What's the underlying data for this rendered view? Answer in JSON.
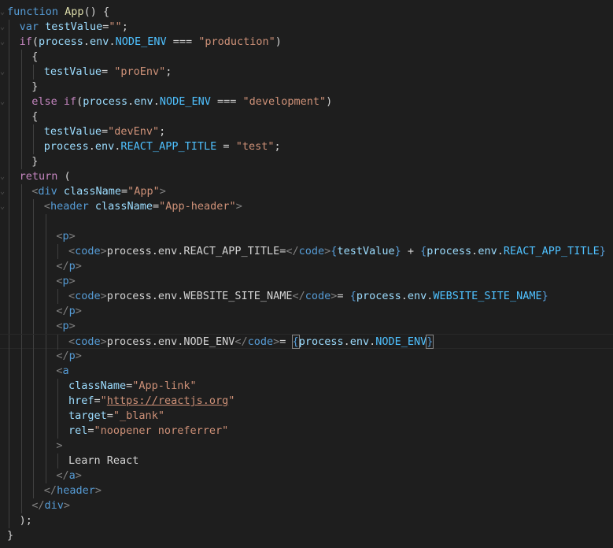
{
  "colors": {
    "background": "#1e1e1e",
    "keyword": "#569cd6",
    "control": "#c586c0",
    "function": "#dcdcaa",
    "variable": "#9cdcfe",
    "constant": "#4fc1ff",
    "string": "#ce9178",
    "tag": "#569cd6",
    "tag_bracket": "#808080",
    "text": "#d4d4d4"
  },
  "editor": {
    "lines": [
      {
        "indent": 0,
        "tokens": [
          [
            "function",
            "k"
          ],
          [
            " ",
            "t"
          ],
          [
            "App",
            "f"
          ],
          [
            "() {",
            "t"
          ]
        ]
      },
      {
        "indent": 1,
        "tokens": [
          [
            "var",
            "k"
          ],
          [
            " ",
            "t"
          ],
          [
            "testValue",
            "v"
          ],
          [
            "=",
            "t"
          ],
          [
            "\"\"",
            "s"
          ],
          [
            ";",
            "t"
          ]
        ]
      },
      {
        "indent": 1,
        "tokens": [
          [
            "if",
            "c"
          ],
          [
            "(",
            "t"
          ],
          [
            "process",
            "v"
          ],
          [
            ".",
            "t"
          ],
          [
            "env",
            "v"
          ],
          [
            ".",
            "t"
          ],
          [
            "NODE_ENV",
            "n"
          ],
          [
            " === ",
            "t"
          ],
          [
            "\"production\"",
            "s"
          ],
          [
            ")",
            "t"
          ]
        ]
      },
      {
        "indent": 2,
        "tokens": [
          [
            "{",
            "t"
          ]
        ]
      },
      {
        "indent": 3,
        "tokens": [
          [
            "testValue",
            "v"
          ],
          [
            "= ",
            "t"
          ],
          [
            "\"proEnv\"",
            "s"
          ],
          [
            ";",
            "t"
          ]
        ]
      },
      {
        "indent": 2,
        "tokens": [
          [
            "}",
            "t"
          ]
        ]
      },
      {
        "indent": 2,
        "tokens": [
          [
            "else",
            "c"
          ],
          [
            " ",
            "t"
          ],
          [
            "if",
            "c"
          ],
          [
            "(",
            "t"
          ],
          [
            "process",
            "v"
          ],
          [
            ".",
            "t"
          ],
          [
            "env",
            "v"
          ],
          [
            ".",
            "t"
          ],
          [
            "NODE_ENV",
            "n"
          ],
          [
            " === ",
            "t"
          ],
          [
            "\"development\"",
            "s"
          ],
          [
            ")",
            "t"
          ]
        ]
      },
      {
        "indent": 2,
        "tokens": [
          [
            "{",
            "t"
          ]
        ]
      },
      {
        "indent": 3,
        "tokens": [
          [
            "testValue",
            "v"
          ],
          [
            "=",
            "t"
          ],
          [
            "\"devEnv\"",
            "s"
          ],
          [
            ";",
            "t"
          ]
        ]
      },
      {
        "indent": 3,
        "tokens": [
          [
            "process",
            "v"
          ],
          [
            ".",
            "t"
          ],
          [
            "env",
            "v"
          ],
          [
            ".",
            "t"
          ],
          [
            "REACT_APP_TITLE",
            "n"
          ],
          [
            " = ",
            "t"
          ],
          [
            "\"test\"",
            "s"
          ],
          [
            ";",
            "t"
          ]
        ]
      },
      {
        "indent": 2,
        "tokens": [
          [
            "}",
            "t"
          ]
        ]
      },
      {
        "indent": 1,
        "tokens": [
          [
            "return",
            "c"
          ],
          [
            " (",
            "t"
          ]
        ]
      },
      {
        "indent": 2,
        "tokens": [
          [
            "<",
            "b"
          ],
          [
            "div",
            "g"
          ],
          [
            " ",
            "t"
          ],
          [
            "className",
            "v"
          ],
          [
            "=",
            "t"
          ],
          [
            "\"App\"",
            "s"
          ],
          [
            ">",
            "b"
          ]
        ]
      },
      {
        "indent": 3,
        "tokens": [
          [
            "<",
            "b"
          ],
          [
            "header",
            "g"
          ],
          [
            " ",
            "t"
          ],
          [
            "className",
            "v"
          ],
          [
            "=",
            "t"
          ],
          [
            "\"App-header\"",
            "s"
          ],
          [
            ">",
            "b"
          ]
        ]
      },
      {
        "indent": 4,
        "tokens": []
      },
      {
        "indent": 4,
        "tokens": [
          [
            "<",
            "b"
          ],
          [
            "p",
            "g"
          ],
          [
            ">",
            "b"
          ]
        ]
      },
      {
        "indent": 5,
        "tokens": [
          [
            "<",
            "b"
          ],
          [
            "code",
            "g"
          ],
          [
            ">",
            "b"
          ],
          [
            "process.env.REACT_APP_TITLE=",
            "t"
          ],
          [
            "</",
            "b"
          ],
          [
            "code",
            "g"
          ],
          [
            ">",
            "b"
          ],
          [
            "{",
            "k"
          ],
          [
            "testValue",
            "v"
          ],
          [
            "}",
            "k"
          ],
          [
            " + ",
            "t"
          ],
          [
            "{",
            "k"
          ],
          [
            "process",
            "v"
          ],
          [
            ".",
            "t"
          ],
          [
            "env",
            "v"
          ],
          [
            ".",
            "t"
          ],
          [
            "REACT_APP_TITLE",
            "n"
          ],
          [
            "}",
            "k"
          ]
        ]
      },
      {
        "indent": 4,
        "tokens": [
          [
            "</",
            "b"
          ],
          [
            "p",
            "g"
          ],
          [
            ">",
            "b"
          ]
        ]
      },
      {
        "indent": 4,
        "tokens": [
          [
            "<",
            "b"
          ],
          [
            "p",
            "g"
          ],
          [
            ">",
            "b"
          ]
        ]
      },
      {
        "indent": 5,
        "tokens": [
          [
            "<",
            "b"
          ],
          [
            "code",
            "g"
          ],
          [
            ">",
            "b"
          ],
          [
            "process.env.WEBSITE_SITE_NAME",
            "t"
          ],
          [
            "</",
            "b"
          ],
          [
            "code",
            "g"
          ],
          [
            ">",
            "b"
          ],
          [
            "= ",
            "t"
          ],
          [
            "{",
            "k"
          ],
          [
            "process",
            "v"
          ],
          [
            ".",
            "t"
          ],
          [
            "env",
            "v"
          ],
          [
            ".",
            "t"
          ],
          [
            "WEBSITE_SITE_NAME",
            "n"
          ],
          [
            "}",
            "k"
          ]
        ]
      },
      {
        "indent": 4,
        "tokens": [
          [
            "</",
            "b"
          ],
          [
            "p",
            "g"
          ],
          [
            ">",
            "b"
          ]
        ]
      },
      {
        "indent": 4,
        "tokens": [
          [
            "<",
            "b"
          ],
          [
            "p",
            "g"
          ],
          [
            ">",
            "b"
          ]
        ]
      },
      {
        "indent": 5,
        "tokens": [
          [
            "<",
            "b"
          ],
          [
            "code",
            "g"
          ],
          [
            ">",
            "b"
          ],
          [
            "process.env.NODE_ENV",
            "t"
          ],
          [
            "</",
            "b"
          ],
          [
            "code",
            "g"
          ],
          [
            ">",
            "b"
          ],
          [
            "= ",
            "t"
          ],
          [
            "{",
            "kb"
          ],
          [
            "process",
            "v"
          ],
          [
            ".",
            "t"
          ],
          [
            "env",
            "v"
          ],
          [
            ".",
            "t"
          ],
          [
            "NODE_ENV",
            "n"
          ],
          [
            "}",
            "kb"
          ]
        ]
      },
      {
        "indent": 4,
        "tokens": [
          [
            "</",
            "b"
          ],
          [
            "p",
            "g"
          ],
          [
            ">",
            "b"
          ]
        ]
      },
      {
        "indent": 4,
        "tokens": [
          [
            "<",
            "b"
          ],
          [
            "a",
            "g"
          ]
        ]
      },
      {
        "indent": 5,
        "tokens": [
          [
            "className",
            "v"
          ],
          [
            "=",
            "t"
          ],
          [
            "\"App-link\"",
            "s"
          ]
        ]
      },
      {
        "indent": 5,
        "tokens": [
          [
            "href",
            "v"
          ],
          [
            "=",
            "t"
          ],
          [
            "\"",
            "s"
          ],
          [
            "https://reactjs.org",
            "su"
          ],
          [
            "\"",
            "s"
          ]
        ]
      },
      {
        "indent": 5,
        "tokens": [
          [
            "target",
            "v"
          ],
          [
            "=",
            "t"
          ],
          [
            "\"_blank\"",
            "s"
          ]
        ]
      },
      {
        "indent": 5,
        "tokens": [
          [
            "rel",
            "v"
          ],
          [
            "=",
            "t"
          ],
          [
            "\"noopener noreferrer\"",
            "s"
          ]
        ]
      },
      {
        "indent": 4,
        "tokens": [
          [
            ">",
            "b"
          ]
        ]
      },
      {
        "indent": 5,
        "tokens": [
          [
            "Learn React",
            "t"
          ]
        ]
      },
      {
        "indent": 4,
        "tokens": [
          [
            "</",
            "b"
          ],
          [
            "a",
            "g"
          ],
          [
            ">",
            "b"
          ]
        ]
      },
      {
        "indent": 3,
        "tokens": [
          [
            "</",
            "b"
          ],
          [
            "header",
            "g"
          ],
          [
            ">",
            "b"
          ]
        ]
      },
      {
        "indent": 2,
        "tokens": [
          [
            "</",
            "b"
          ],
          [
            "div",
            "g"
          ],
          [
            ">",
            "b"
          ]
        ]
      },
      {
        "indent": 1,
        "tokens": [
          [
            ");",
            "t"
          ]
        ]
      },
      {
        "indent": 0,
        "tokens": [
          [
            "}",
            "t"
          ]
        ]
      }
    ]
  }
}
